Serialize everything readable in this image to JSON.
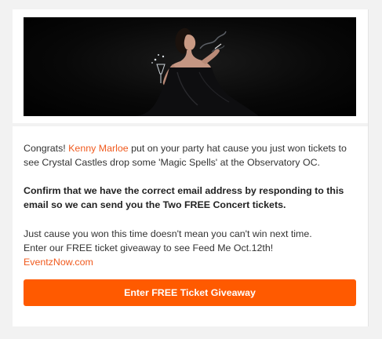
{
  "hero": {
    "image_alt": "Woman in black dress holding a champagne glass and blowing smoke"
  },
  "message": {
    "congrats_prefix": "Congrats! ",
    "winner_name": "Kenny Marloe",
    "congrats_suffix": " put on your party hat cause you just won tickets to see Crystal Castles drop some 'Magic Spells' at the Observatory OC.",
    "confirm_text": "Confirm that we have the correct email address by responding to this email so we can send you the Two FREE Concert tickets.",
    "next_time_line1": "Just cause you won this time doesn't mean you can't win next time.",
    "next_time_line2": "Enter our FREE ticket giveaway to see Feed Me Oct.12th!",
    "site_link": "EventzNow.com"
  },
  "cta": {
    "label": "Enter FREE Ticket Giveaway"
  },
  "colors": {
    "accent": "#ff5a00",
    "link": "#f05a1e",
    "background": "#f2f2f2",
    "card": "#ffffff",
    "text": "#333333"
  }
}
